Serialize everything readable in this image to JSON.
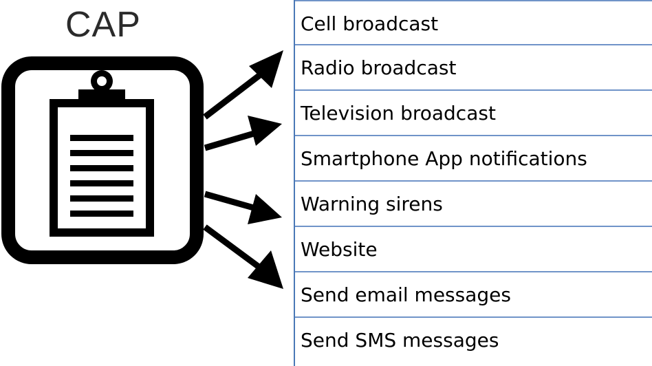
{
  "diagram": {
    "source_label": "CAP",
    "source_icon": "clipboard-icon",
    "channels": [
      "Cell broadcast",
      "Radio broadcast",
      "Television broadcast",
      "Smartphone App notifications",
      "Warning sirens",
      "Website",
      "Send email messages",
      "Send SMS messages"
    ]
  }
}
